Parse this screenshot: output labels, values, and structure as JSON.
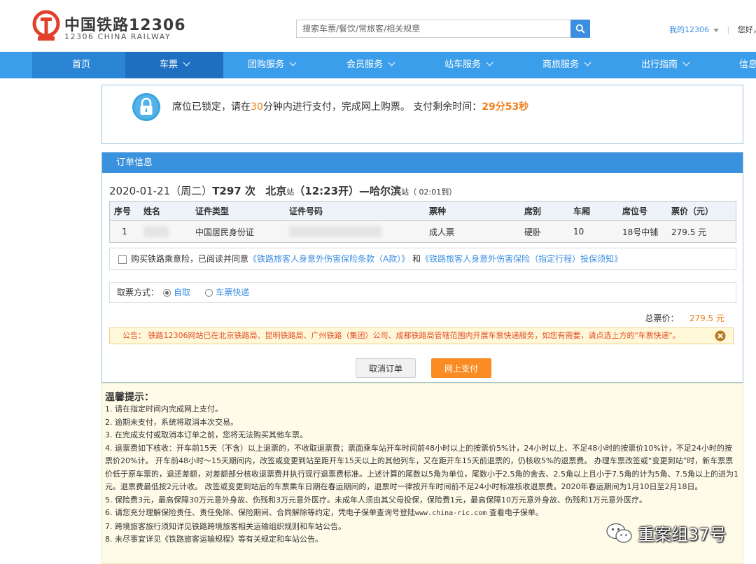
{
  "header": {
    "logo_cn": "中国铁路12306",
    "logo_en": "12306 CHINA RAILWAY",
    "search_placeholder": "搜索车票/餐饮/常旅客/相关规章",
    "my12306": "我的12306",
    "sep": "|",
    "greeting": "您好，"
  },
  "nav": [
    {
      "label": "首页"
    },
    {
      "label": "车票"
    },
    {
      "label": "团购服务"
    },
    {
      "label": "会员服务"
    },
    {
      "label": "站车服务"
    },
    {
      "label": "商旅服务"
    },
    {
      "label": "出行指南"
    },
    {
      "label": "信息"
    }
  ],
  "lock": {
    "pre": "席位已锁定，请在",
    "minutes": "30",
    "mid": "分钟内进行支付，完成网上购票。 支付剩余时间：",
    "remaining": "29分53秒"
  },
  "order": {
    "title": "订单信息",
    "date": "2020-01-21",
    "weekday": "（周二）",
    "train": "T297 次",
    "from": "北京",
    "station_suffix": "站",
    "depart": "（12:23开）",
    "dash": "—",
    "to": "哈尔滨",
    "arrive": "（ 02:01到）",
    "columns": [
      "序号",
      "姓名",
      "证件类型",
      "证件号码",
      "票种",
      "席别",
      "车厢",
      "席位号",
      "票价（元）"
    ],
    "rows": [
      {
        "no": "1",
        "id_type": "中国居民身份证",
        "ticket_type": "成人票",
        "seat_class": "硬卧",
        "car": "10",
        "seat": "18号中铺",
        "price": "279.5 元"
      }
    ]
  },
  "insurance": {
    "pre": "购买铁路乘意险，已阅读并同意",
    "link1": "《铁路旅客人身意外伤害保险条款（A款）》",
    "and": "和",
    "link2": "《铁路旅客人身意外伤害保险（指定行程）投保须知》"
  },
  "pickup": {
    "label": "取票方式：",
    "opt1": "自取",
    "opt2": "车票快递"
  },
  "total": {
    "label": "总票价：",
    "value": "279.5 元"
  },
  "notice": "公告：  铁路12306网站已在北京铁路局、昆明铁路局、广州铁路（集团）公司、成都铁路局管辖范围内开展车票快递服务，如您有需要，请点选上方的\"车票快递\"。",
  "buttons": {
    "cancel": "取消订单",
    "pay": "网上支付"
  },
  "tips": {
    "title": "温馨提示：",
    "items": [
      "1. 请在指定时间内完成网上支付。",
      "2. 逾期未支付，系统将取消本次交易。",
      "3. 在完成支付或取消本订单之前，您将无法购买其他车票。",
      "4. 退票费如下核收：开车前15天（不含）以上退票的，不收取退票费；票面乘车站开车时间前48小时以上的按票价5%计，24小时以上、不足48小时的按票价10%计，不足24小时的按票价20%计。 开车前48小时～15天期间内，改签或变更到站至距开车15天以上的其他列车，又在距开车15天前退票的，仍核收5%的退票费。 办理车票改签或“变更到站”时，新车票票价低于原车票的，退还差额，对差额部分核收退票费并执行现行退票费标准。上述计算的尾数以5角为单位，尾数小于2.5角的舍去、2.5角以上且小于7.5角的计为5角、7.5角以上的进为1元。退票费最低按2元计收。 改签或变更到站后的车票乘车日期在春运期间的，退票时一律按开车时间前不足24小时标准核收退票费。2020年春运期间为1月10日至2月18日。",
      "5. 保险费3元，最高保障30万元意外身故、伤残和3万元意外医疗。未成年人须由其父母投保，保险费1元，最高保障10万元意外身故、伤残和1万元意外医疗。",
      "7. 跨境旅客旅行须知详见铁路跨境旅客相关运输组织规则和车站公告。",
      "8. 未尽事宜详见《铁路旅客运输规程》等有关规定和车站公告。"
    ],
    "item6_pre": "6. 请您充分理解保险责任、责任免除、保险期间、合同解除等约定，凭电子保单查询号登陆",
    "item6_url": "www.china-ric.com",
    "item6_post": " 查看电子保单。"
  },
  "watermark": "重案组37号"
}
